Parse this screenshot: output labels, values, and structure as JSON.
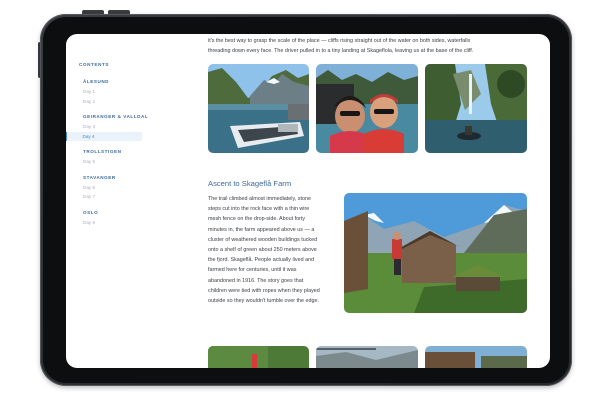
{
  "sidebar": {
    "heading": "CONTENTS",
    "sections": [
      {
        "title": "ÅLESUND",
        "days": [
          "Day 1",
          "Day 2"
        ]
      },
      {
        "title": "GEIRANGER & VALLDAL",
        "days": [
          "Day 3",
          "Day 4"
        ]
      },
      {
        "title": "TROLLSTIGEN",
        "days": [
          "Day 5"
        ]
      },
      {
        "title": "STAVANGER",
        "days": [
          "Day 6",
          "Day 7"
        ]
      },
      {
        "title": "OSLO",
        "days": [
          "Day 8"
        ]
      }
    ],
    "active_day": "Day 4"
  },
  "article": {
    "intro_line1": "it's the best way to grasp the scale of the place — cliffs rising straight out of the water on both sides, waterfalls",
    "intro_line2": "threading down every face. The driver pulled in to a tiny landing at Skageflola, leaving us at the base of the cliff.",
    "section_title": "Ascent to Skageflå Farm",
    "body": "The trail climbed almost immediately, stone steps cut into the rock face with a thin wire mesh fence on the drop-side. About forty minutes in, the farm appeared above us — a cluster of weathered wooden buildings tucked onto a shelf of green about 250 meters above the fjord. Skageflå. People actually lived and farmed here for centuries, until it was abandoned in 1916. The story goes that children were tied with ropes when they played outside so they wouldn't tumble over the edge."
  },
  "photos": [
    {
      "name": "fjord-boat-photo"
    },
    {
      "name": "couple-selfie-photo"
    },
    {
      "name": "kayak-waterfall-photo"
    },
    {
      "name": "skageflaa-farm-photo"
    },
    {
      "name": "bottom-photo-1"
    },
    {
      "name": "bottom-photo-2"
    },
    {
      "name": "bottom-photo-3"
    }
  ],
  "colors": {
    "accent": "#3b6aa0",
    "active_day": "#4a8ad4",
    "frame": "#2b2d31"
  }
}
